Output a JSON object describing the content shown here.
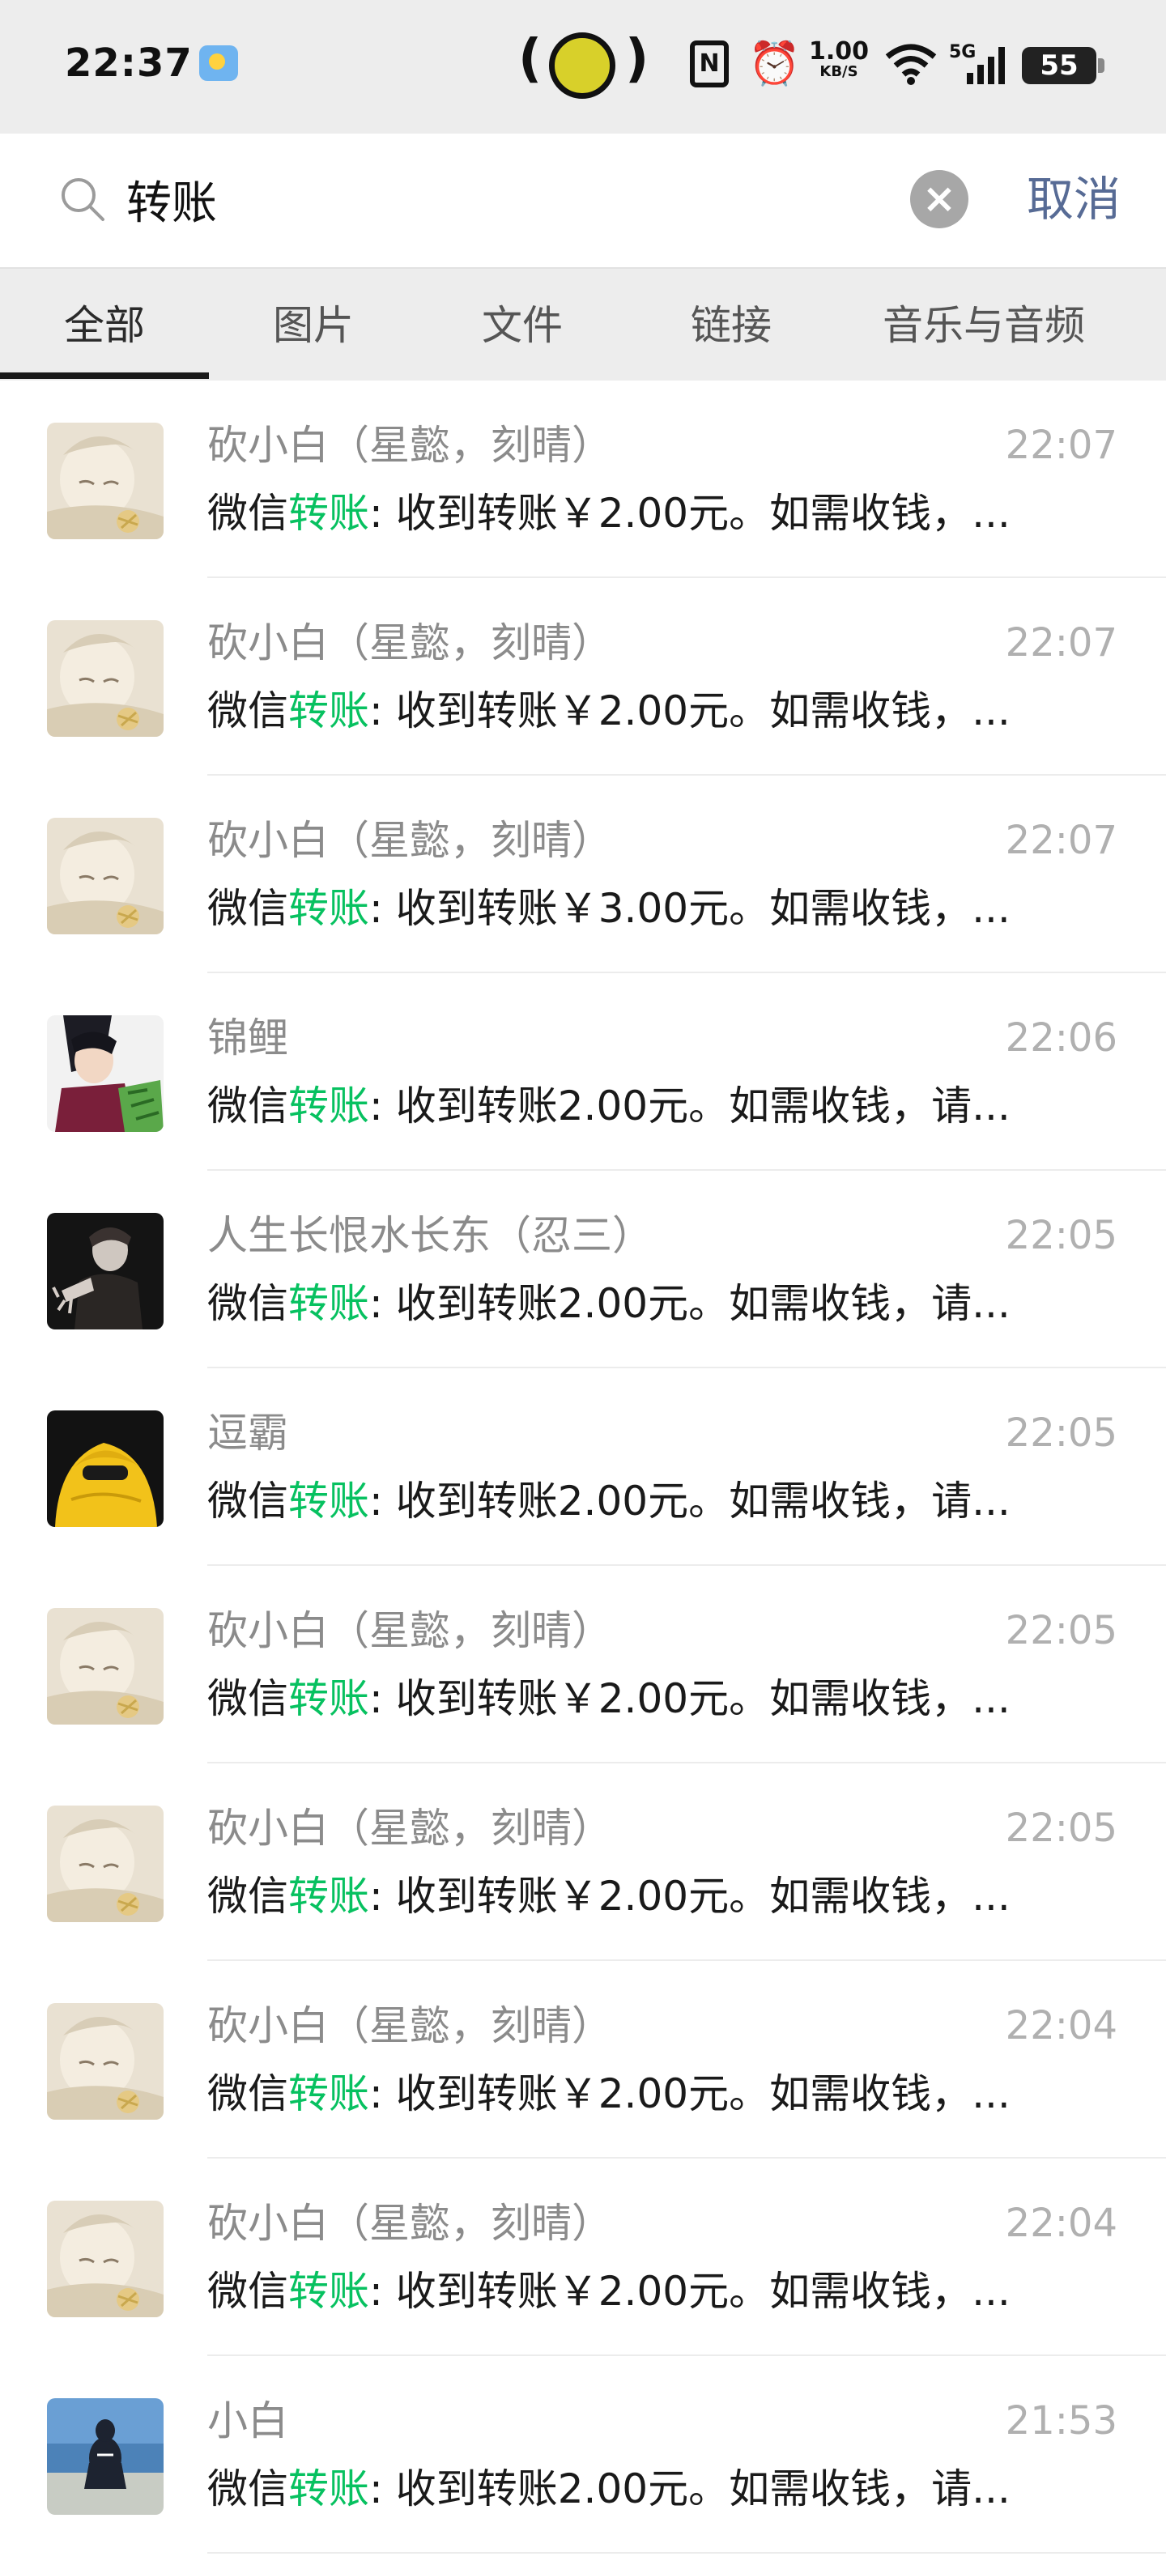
{
  "status_bar": {
    "time": "22:37",
    "nfc_label": "N",
    "speed_value": "1.00",
    "speed_unit": "KB/S",
    "network": "5G",
    "battery": "55"
  },
  "search": {
    "query": "转账",
    "cancel_label": "取消"
  },
  "tabs": [
    {
      "label": "全部",
      "active": true
    },
    {
      "label": "图片",
      "active": false
    },
    {
      "label": "文件",
      "active": false
    },
    {
      "label": "链接",
      "active": false
    },
    {
      "label": "音乐与音频",
      "active": false
    }
  ],
  "results": [
    {
      "name": "砍小白（星懿，刻晴）",
      "time": "22:07",
      "prefix": "微信",
      "highlight": "转账",
      "suffix": ": 收到转账￥2.00元。如需收钱，...",
      "avatar": "anime-sleeping"
    },
    {
      "name": "砍小白（星懿，刻晴）",
      "time": "22:07",
      "prefix": "微信",
      "highlight": "转账",
      "suffix": ": 收到转账￥2.00元。如需收钱，...",
      "avatar": "anime-sleeping"
    },
    {
      "name": "砍小白（星懿，刻晴）",
      "time": "22:07",
      "prefix": "微信",
      "highlight": "转账",
      "suffix": ": 收到转账￥3.00元。如需收钱，...",
      "avatar": "anime-sleeping"
    },
    {
      "name": "锦鲤",
      "time": "22:06",
      "prefix": "微信",
      "highlight": "转账",
      "suffix": ": 收到转账2.00元。如需收钱，请...",
      "avatar": "anime-character"
    },
    {
      "name": "人生长恨水长东（忍三）",
      "time": "22:05",
      "prefix": "微信",
      "highlight": "转账",
      "suffix": ": 收到转账2.00元。如需收钱，请...",
      "avatar": "dark-portrait"
    },
    {
      "name": "逗霸",
      "time": "22:05",
      "prefix": "微信",
      "highlight": "转账",
      "suffix": ": 收到转账2.00元。如需收钱，请...",
      "avatar": "yellow-hoodie"
    },
    {
      "name": "砍小白（星懿，刻晴）",
      "time": "22:05",
      "prefix": "微信",
      "highlight": "转账",
      "suffix": ": 收到转账￥2.00元。如需收钱，...",
      "avatar": "anime-sleeping"
    },
    {
      "name": "砍小白（星懿，刻晴）",
      "time": "22:05",
      "prefix": "微信",
      "highlight": "转账",
      "suffix": ": 收到转账￥2.00元。如需收钱，...",
      "avatar": "anime-sleeping"
    },
    {
      "name": "砍小白（星懿，刻晴）",
      "time": "22:04",
      "prefix": "微信",
      "highlight": "转账",
      "suffix": ": 收到转账￥2.00元。如需收钱，...",
      "avatar": "anime-sleeping"
    },
    {
      "name": "砍小白（星懿，刻晴）",
      "time": "22:04",
      "prefix": "微信",
      "highlight": "转账",
      "suffix": ": 收到转账￥2.00元。如需收钱，...",
      "avatar": "anime-sleeping"
    },
    {
      "name": "小白",
      "time": "21:53",
      "prefix": "微信",
      "highlight": "转账",
      "suffix": ": 收到转账2.00元。如需收钱，请...",
      "avatar": "sea-photo"
    }
  ],
  "colors": {
    "highlight": "#07c160",
    "link": "#576b95",
    "background": "#ededed"
  }
}
